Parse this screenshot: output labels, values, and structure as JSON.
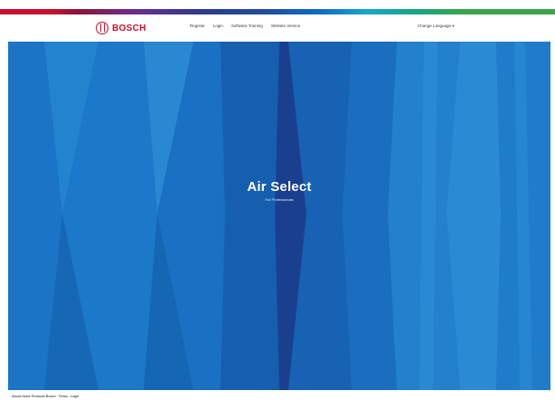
{
  "brand": {
    "logo_text": "BOSCH",
    "logo_icon": "bosch-armature-icon",
    "primary_color": "#c8102e",
    "stripe_colors": [
      "#c8102e",
      "#6b2c91",
      "#2e3a8c",
      "#0e6fc1",
      "#1aa7c9",
      "#18a48c",
      "#3aa54a"
    ]
  },
  "nav": {
    "items": [
      "Register",
      "Login",
      "Software Training",
      "Website Version"
    ]
  },
  "language": {
    "label": "Change Language ▾"
  },
  "hero": {
    "title": "Air Select",
    "subtitle": "For Professionals",
    "background_color": "#1a6fc0"
  },
  "footer": {
    "text": "About Home Products Bosch · Terms · Legal"
  }
}
